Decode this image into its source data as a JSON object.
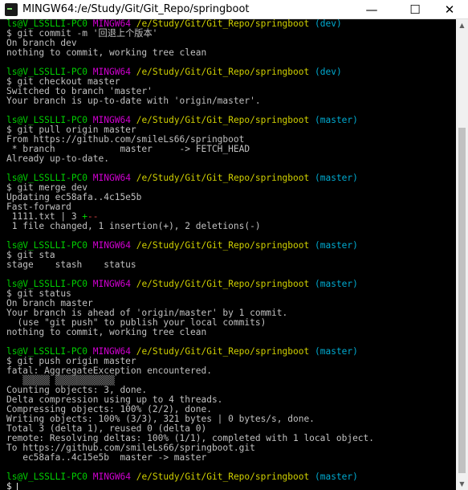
{
  "window": {
    "title": "MINGW64:/e/Study/Git/Git_Repo/springboot",
    "minimize_label": "—",
    "maximize_label": "☐",
    "close_label": "✕"
  },
  "prompt": {
    "user_host": "ls@V_LSSLLI-PC0",
    "env": "MINGW64",
    "path": "/e/Study/Git/Git_Repo/springboot",
    "cursor_symbol": "$"
  },
  "terminal": {
    "lines": [
      {
        "type": "prompt",
        "branch": "(dev)"
      },
      {
        "type": "text",
        "text": "$ git commit -m '回退上个版本'"
      },
      {
        "type": "text",
        "text": "On branch dev"
      },
      {
        "type": "text",
        "text": "nothing to commit, working tree clean"
      },
      {
        "type": "blank"
      },
      {
        "type": "prompt",
        "branch": "(dev)"
      },
      {
        "type": "text",
        "text": "$ git checkout master"
      },
      {
        "type": "text",
        "text": "Switched to branch 'master'"
      },
      {
        "type": "text",
        "text": "Your branch is up-to-date with 'origin/master'."
      },
      {
        "type": "blank"
      },
      {
        "type": "prompt",
        "branch": "(master)"
      },
      {
        "type": "text",
        "text": "$ git pull origin master"
      },
      {
        "type": "text",
        "text": "From https://github.com/smileLs66/springboot"
      },
      {
        "type": "text",
        "text": " * branch            master     -> FETCH_HEAD"
      },
      {
        "type": "text",
        "text": "Already up-to-date."
      },
      {
        "type": "blank"
      },
      {
        "type": "prompt",
        "branch": "(master)"
      },
      {
        "type": "text",
        "text": "$ git merge dev"
      },
      {
        "type": "text",
        "text": "Updating ec58afa..4c15e5b"
      },
      {
        "type": "text",
        "text": "Fast-forward"
      },
      {
        "type": "stat",
        "file": " 1111.txt | 3 ",
        "plus": "+",
        "minus": "--"
      },
      {
        "type": "text",
        "text": " 1 file changed, 1 insertion(+), 2 deletions(-)"
      },
      {
        "type": "blank"
      },
      {
        "type": "prompt",
        "branch": "(master)"
      },
      {
        "type": "text",
        "text": "$ git sta"
      },
      {
        "type": "text",
        "text": "stage    stash    status"
      },
      {
        "type": "blank"
      },
      {
        "type": "prompt",
        "branch": "(master)"
      },
      {
        "type": "text",
        "text": "$ git status"
      },
      {
        "type": "text",
        "text": "On branch master"
      },
      {
        "type": "text",
        "text": "Your branch is ahead of 'origin/master' by 1 commit."
      },
      {
        "type": "text",
        "text": "  (use \"git push\" to publish your local commits)"
      },
      {
        "type": "text",
        "text": "nothing to commit, working tree clean"
      },
      {
        "type": "blank"
      },
      {
        "type": "prompt",
        "branch": "(master)"
      },
      {
        "type": "text",
        "text": "$ git push origin master"
      },
      {
        "type": "text",
        "text": "fatal: AggregateException encountered."
      },
      {
        "type": "garbled",
        "text": "   ▒▒▒▒▒ ▒▒▒▒▒▒▒▒▒▒▒"
      },
      {
        "type": "text",
        "text": "Counting objects: 3, done."
      },
      {
        "type": "text",
        "text": "Delta compression using up to 4 threads."
      },
      {
        "type": "text",
        "text": "Compressing objects: 100% (2/2), done."
      },
      {
        "type": "text",
        "text": "Writing objects: 100% (3/3), 321 bytes | 0 bytes/s, done."
      },
      {
        "type": "text",
        "text": "Total 3 (delta 1), reused 0 (delta 0)"
      },
      {
        "type": "text",
        "text": "remote: Resolving deltas: 100% (1/1), completed with 1 local object."
      },
      {
        "type": "text",
        "text": "To https://github.com/smileLs66/springboot.git"
      },
      {
        "type": "text",
        "text": "   ec58afa..4c15e5b  master -> master"
      },
      {
        "type": "blank"
      },
      {
        "type": "prompt",
        "branch": "(master)"
      },
      {
        "type": "cursor",
        "text": "$ "
      }
    ]
  },
  "colors": {
    "background": "#000000",
    "user_host": "#00d000",
    "env": "#d000d0",
    "path": "#d0d000",
    "branch": "#00aad0",
    "text": "#c0c0c0"
  },
  "icons": {
    "app": "mingw-terminal-icon",
    "scroll_up": "▲",
    "scroll_down": "▼"
  }
}
